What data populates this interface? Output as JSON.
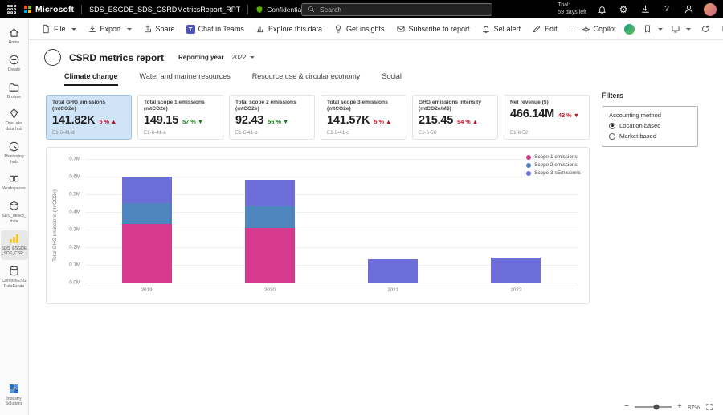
{
  "topbar": {
    "brand": "Microsoft",
    "report_name": "SDS_ESGDE_SDS_CSRDMetricsReport_RPT",
    "sensitivity": "Confidential\\Microsoft Extended",
    "search_placeholder": "Search",
    "trial_line1": "Trial:",
    "trial_line2": "59 days left"
  },
  "icons": {
    "help": "?",
    "gear": "⚙",
    "star": "☆",
    "back": "←"
  },
  "toolbar": {
    "items": [
      {
        "label": "File"
      },
      {
        "label": "Export"
      },
      {
        "label": "Share"
      },
      {
        "label": "Chat in Teams"
      },
      {
        "label": "Explore this data"
      },
      {
        "label": "Get insights"
      },
      {
        "label": "Subscribe to report"
      },
      {
        "label": "Set alert"
      },
      {
        "label": "Edit"
      },
      {
        "label": "…"
      }
    ],
    "copilot_label": "Copilot"
  },
  "sidebar": {
    "items": [
      {
        "label": "Home"
      },
      {
        "label": "Create"
      },
      {
        "label": "Browse"
      },
      {
        "label": "OneLake data hub"
      },
      {
        "label": "Monitoring hub"
      },
      {
        "label": "Workspaces"
      },
      {
        "label": "SDS_devko_ data"
      },
      {
        "label": "SDS_ESGDE _SDS_CSR...",
        "active": true
      },
      {
        "label": "ContosoESG DataEstate"
      },
      {
        "label": "Industry Solutions"
      }
    ]
  },
  "report": {
    "title": "CSRD metrics report",
    "reporting_year_label": "Reporting year",
    "reporting_year_value": "2022",
    "tabs": [
      "Climate change",
      "Water and marine resources",
      "Resource use & circular economy",
      "Social"
    ],
    "active_tab": "Climate change"
  },
  "cards": [
    {
      "title": "Total GHG emissions (mtCO2e)",
      "value": "141.82K",
      "delta": "5 %",
      "arrow": "▲",
      "delta_style": "color:#c50f1f",
      "code": "E1-6-41-d",
      "selected": true
    },
    {
      "title": "Total scope 1 emissions (mtCO2e)",
      "value": "149.15",
      "delta": "57 %",
      "arrow": "▼",
      "delta_style": "color:#107c10",
      "code": "E1-6-41-a"
    },
    {
      "title": "Total scope 2 emissions (mtCO2e)",
      "value": "92.43",
      "delta": "56 %",
      "arrow": "▼",
      "delta_style": "color:#107c10",
      "code": "E1-6-41-b"
    },
    {
      "title": "Total scope 3 emissions (mtCO2e)",
      "value": "141.57K",
      "delta": "5 %",
      "arrow": "▲",
      "delta_style": "color:#c50f1f",
      "code": "E1-6-41-c"
    },
    {
      "title": "GHG emissions intensity (mtCO2e/M$)",
      "value": "215.45",
      "delta": "94 %",
      "arrow": "▲",
      "delta_style": "color:#c50f1f",
      "code": "E1-6-50"
    },
    {
      "title": "Net revenue ($)",
      "value": "466.14M",
      "delta": "43 %",
      "arrow": "▼",
      "delta_style": "color:#c50f1f",
      "code": "E1-6-52"
    }
  ],
  "chart_data": {
    "type": "bar",
    "stacked": true,
    "title": "",
    "categories": [
      "2019",
      "2020",
      "2021",
      "2022"
    ],
    "series": [
      {
        "name": "Scope 1 emissions",
        "color": "#d53a8c",
        "values": [
          0.33,
          0.31,
          0,
          0
        ]
      },
      {
        "name": "Scope 2 emissions",
        "color": "#4f86c0",
        "values": [
          0.12,
          0.12,
          0,
          0
        ]
      },
      {
        "name": "Scope 3 eEmissions",
        "color": "#6d6ed8",
        "values": [
          0.15,
          0.15,
          0.13,
          0.14
        ]
      }
    ],
    "xlabel": "",
    "ylabel": "Total GHG emissions (mtCO2e)",
    "ylim": [
      0,
      0.7
    ],
    "yticks": [
      0,
      0.1,
      0.2,
      0.3,
      0.4,
      0.5,
      0.6,
      0.7
    ],
    "ytick_suffix": "M",
    "grid": true,
    "legend_position": "top-right"
  },
  "filters": {
    "title": "Filters",
    "group_label": "Accounting method",
    "options": [
      {
        "label": "Location based",
        "selected": true
      },
      {
        "label": "Market based",
        "selected": false
      }
    ]
  },
  "statusbar": {
    "zoom_out": "−",
    "zoom_in": "+",
    "zoom_level": "87%"
  }
}
